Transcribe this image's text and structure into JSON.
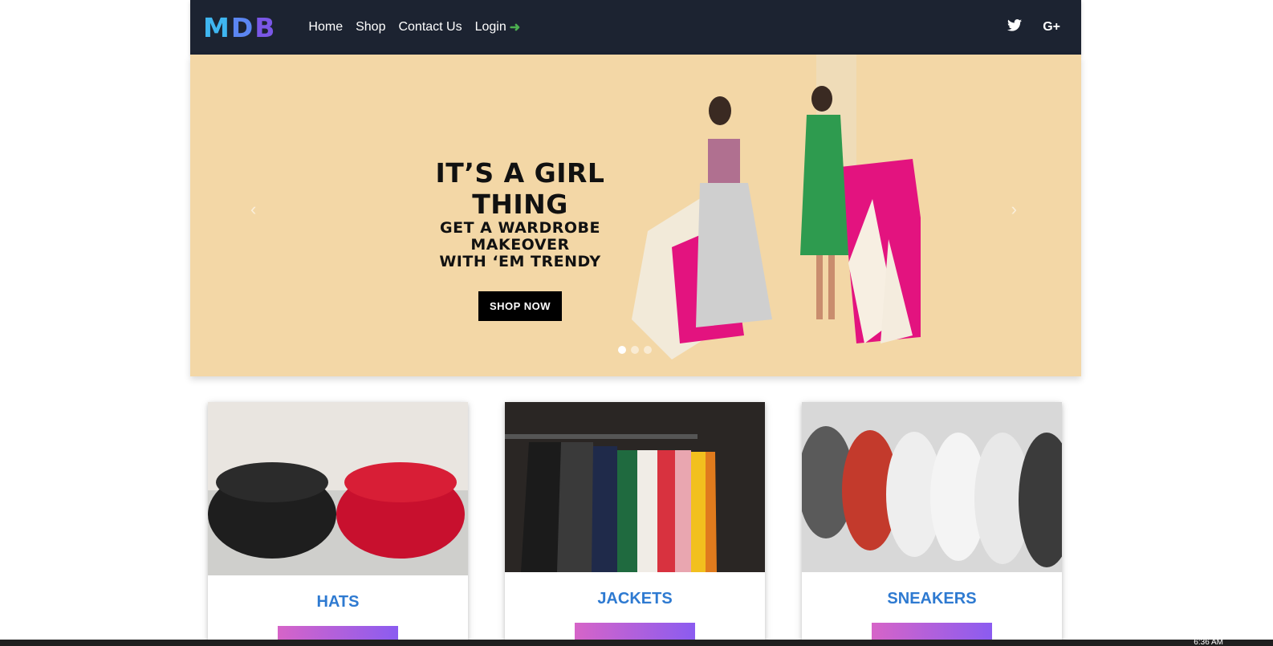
{
  "navbar": {
    "logo": "MDB",
    "links": [
      {
        "label": "Home"
      },
      {
        "label": "Shop"
      },
      {
        "label": "Contact Us"
      },
      {
        "label": "Login"
      }
    ],
    "social": [
      "twitter-icon",
      "google-plus-icon"
    ]
  },
  "carousel": {
    "title": "IT’S A GIRL THING",
    "subtitle_line1": "GET A WARDROBE MAKEOVER",
    "subtitle_line2": "WITH ‘EM TRENDY",
    "cta": "SHOP NOW",
    "prev": "‹",
    "next": "›",
    "slides": 3,
    "active_slide": 1,
    "background": "#f3d7a6"
  },
  "cards": [
    {
      "title": "HATS"
    },
    {
      "title": "JACKETS"
    },
    {
      "title": "SNEAKERS"
    }
  ],
  "taskbar": {
    "clock": "6:36 AM"
  },
  "colors": {
    "navbar": "#1c2331",
    "card_title": "#2e7ad1",
    "accent_green": "#4caf50"
  }
}
